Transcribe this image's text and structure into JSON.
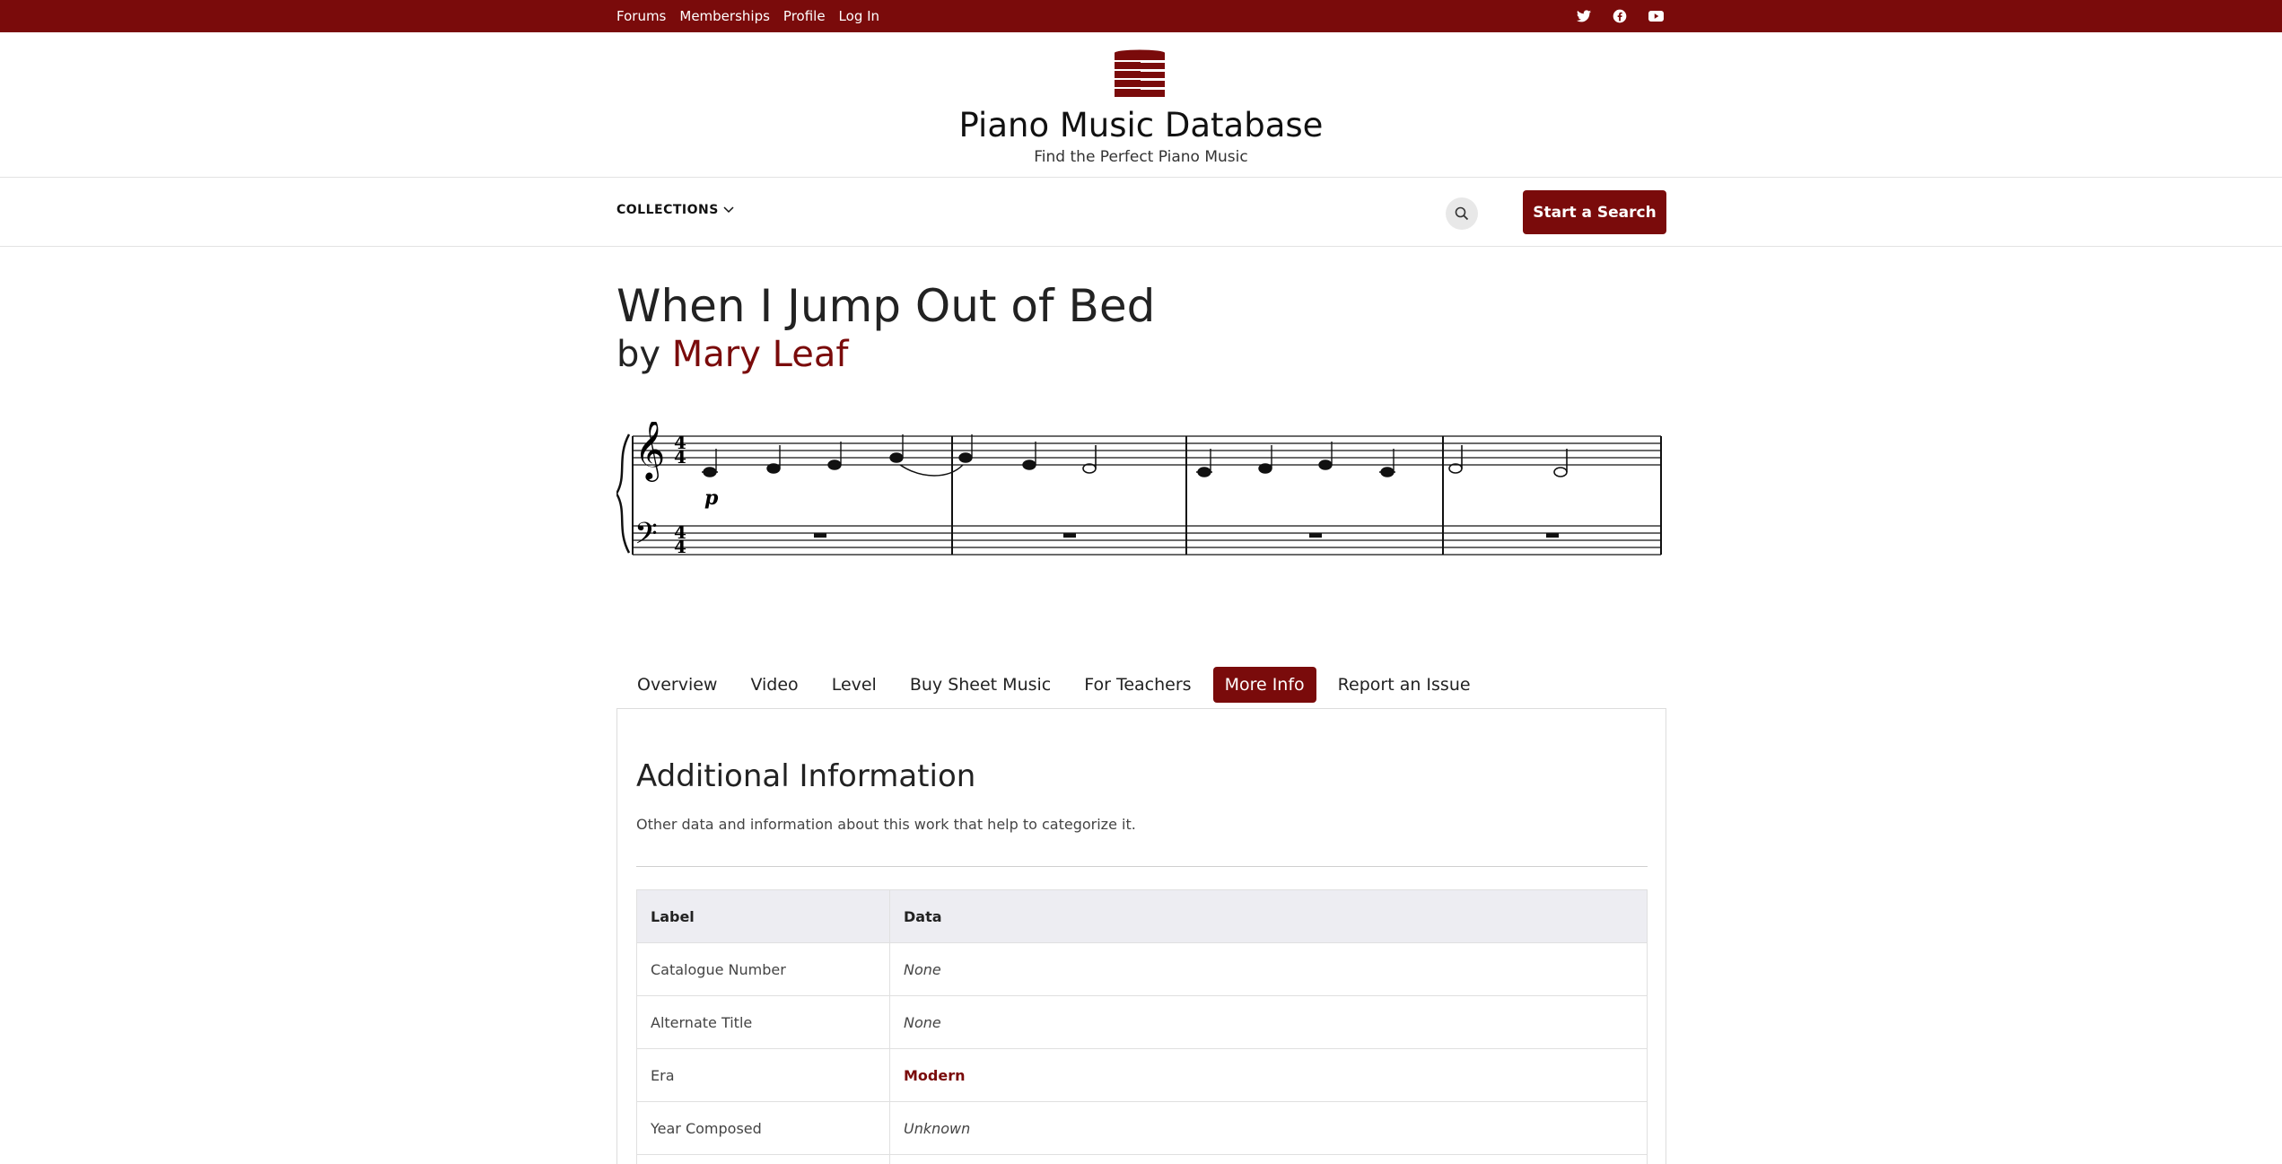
{
  "topbar": {
    "links": [
      "Forums",
      "Memberships",
      "Profile",
      "Log In"
    ],
    "social_icons": [
      "twitter-icon",
      "facebook-icon",
      "youtube-icon"
    ],
    "color": "#7a0b0b"
  },
  "site": {
    "title": "Piano Music Database",
    "tagline": "Find the Perfect Piano Music",
    "logo_icon": "piano-keys-logo"
  },
  "nav": {
    "collections_label": "COLLECTIONS",
    "search_icon": "search-icon",
    "start_button": "Start a Search"
  },
  "work": {
    "title": "When I Jump Out of Bed",
    "by": "by",
    "composer": "Mary Leaf"
  },
  "score": {
    "time_signature": "4/4",
    "dynamic": "p",
    "measures": 4
  },
  "tabs": [
    {
      "label": "Overview",
      "active": false
    },
    {
      "label": "Video",
      "active": false
    },
    {
      "label": "Level",
      "active": false
    },
    {
      "label": "Buy Sheet Music",
      "active": false
    },
    {
      "label": "For Teachers",
      "active": false
    },
    {
      "label": "More Info",
      "active": true
    },
    {
      "label": "Report an Issue",
      "active": false
    }
  ],
  "panel": {
    "title": "Additional Information",
    "description": "Other data and information about this work that help to categorize it.",
    "table": {
      "headers": [
        "Label",
        "Data"
      ],
      "rows": [
        {
          "label": "Catalogue Number",
          "data": "None"
        },
        {
          "label": "Alternate Title",
          "data": "None"
        },
        {
          "label": "Era",
          "data": "Modern"
        },
        {
          "label": "Year Composed",
          "data": "Unknown"
        }
      ]
    }
  }
}
